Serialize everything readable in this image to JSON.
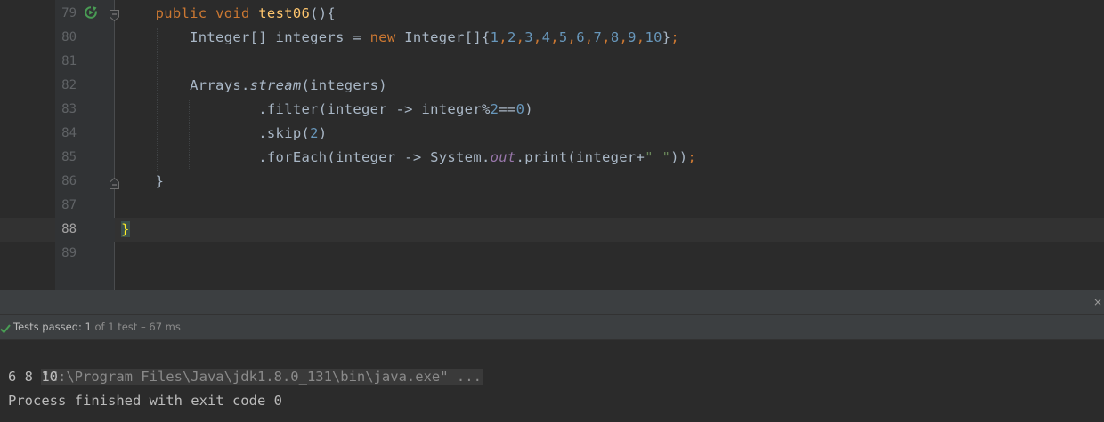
{
  "editor": {
    "lines": [
      {
        "num": "79",
        "parts": [
          {
            "t": "    "
          },
          {
            "t": "public void ",
            "c": "kw"
          },
          {
            "t": "test06",
            "c": "fn"
          },
          {
            "t": "(){"
          }
        ]
      },
      {
        "num": "80",
        "parts": [
          {
            "t": "        Integer[] integers = "
          },
          {
            "t": "new ",
            "c": "kw"
          },
          {
            "t": "Integer[]{"
          },
          {
            "t": "1",
            "c": "num"
          },
          {
            "t": ",",
            "c": "kw"
          },
          {
            "t": "2",
            "c": "num"
          },
          {
            "t": ",",
            "c": "kw"
          },
          {
            "t": "3",
            "c": "num"
          },
          {
            "t": ",",
            "c": "kw"
          },
          {
            "t": "4",
            "c": "num"
          },
          {
            "t": ",",
            "c": "kw"
          },
          {
            "t": "5",
            "c": "num"
          },
          {
            "t": ",",
            "c": "kw"
          },
          {
            "t": "6",
            "c": "num"
          },
          {
            "t": ",",
            "c": "kw"
          },
          {
            "t": "7",
            "c": "num"
          },
          {
            "t": ",",
            "c": "kw"
          },
          {
            "t": "8",
            "c": "num"
          },
          {
            "t": ",",
            "c": "kw"
          },
          {
            "t": "9",
            "c": "num"
          },
          {
            "t": ",",
            "c": "kw"
          },
          {
            "t": "10",
            "c": "num"
          },
          {
            "t": "}"
          },
          {
            "t": ";",
            "c": "kw"
          }
        ]
      },
      {
        "num": "81",
        "parts": []
      },
      {
        "num": "82",
        "parts": [
          {
            "t": "        Arrays."
          },
          {
            "t": "stream",
            "c": "it"
          },
          {
            "t": "(integers)"
          }
        ]
      },
      {
        "num": "83",
        "parts": [
          {
            "t": "                .filter(integer -> integer%"
          },
          {
            "t": "2",
            "c": "num"
          },
          {
            "t": "=="
          },
          {
            "t": "0",
            "c": "num"
          },
          {
            "t": ")"
          }
        ]
      },
      {
        "num": "84",
        "parts": [
          {
            "t": "                .skip("
          },
          {
            "t": "2",
            "c": "num"
          },
          {
            "t": ")"
          }
        ]
      },
      {
        "num": "85",
        "parts": [
          {
            "t": "                .forEach(integer -> System."
          },
          {
            "t": "out",
            "c": "fld"
          },
          {
            "t": ".print(integer+"
          },
          {
            "t": "\" \"",
            "c": "str"
          },
          {
            "t": "))"
          },
          {
            "t": ";",
            "c": "kw"
          }
        ]
      },
      {
        "num": "86",
        "parts": [
          {
            "t": "    }"
          }
        ]
      },
      {
        "num": "87",
        "parts": []
      },
      {
        "num": "88",
        "parts": [
          {
            "t": "}",
            "c": "brace-hl"
          }
        ],
        "current": true
      },
      {
        "num": "89",
        "parts": []
      }
    ]
  },
  "colors": {
    "keyword": "#cc7832",
    "function": "#ffc66d",
    "number": "#6897bb",
    "string": "#6a8759",
    "field": "#9876aa",
    "pass": "#499c54"
  },
  "icons": {
    "run": "run-test-icon",
    "fold": "fold-marker-icon",
    "check": "check-icon",
    "close": "close-icon"
  },
  "status": {
    "prefix": "Tests passed: ",
    "passed": "1",
    "detail": " of 1 test – 67 ms"
  },
  "console": {
    "command": "\"C:\\Program Files\\Java\\jdk1.8.0_131\\bin\\java.exe\" ...",
    "output": "6 8 10",
    "exit": "Process finished with exit code 0"
  },
  "toolbar": {
    "close_glyph": "×"
  }
}
